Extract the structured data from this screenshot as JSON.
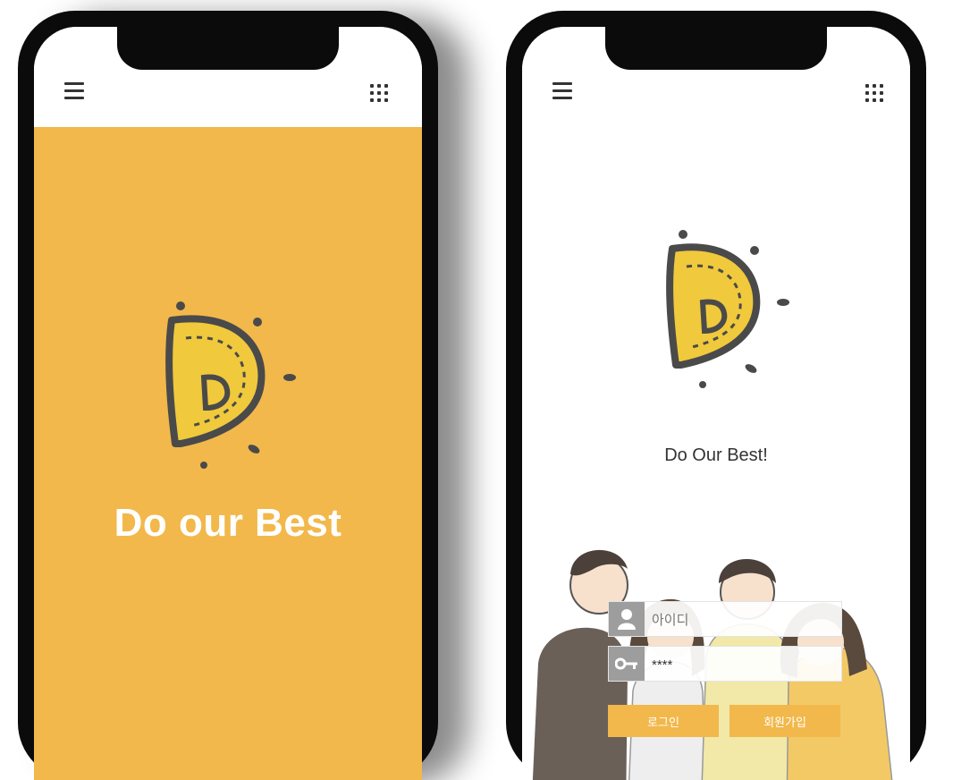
{
  "splash": {
    "title": "Do our Best",
    "logo_letter": "D",
    "background_color": "#f2b84b"
  },
  "login": {
    "tagline": "Do Our Best!",
    "logo_letter": "D",
    "id_field": {
      "placeholder": "아이디",
      "value": ""
    },
    "password_field": {
      "value": "****"
    },
    "login_button_label": "로그인",
    "signup_button_label": "회원가입",
    "accent_color": "#f2b84b"
  },
  "icons": {
    "menu": "menu-icon",
    "apps": "grid-icon",
    "user": "user-icon",
    "key": "key-icon"
  }
}
